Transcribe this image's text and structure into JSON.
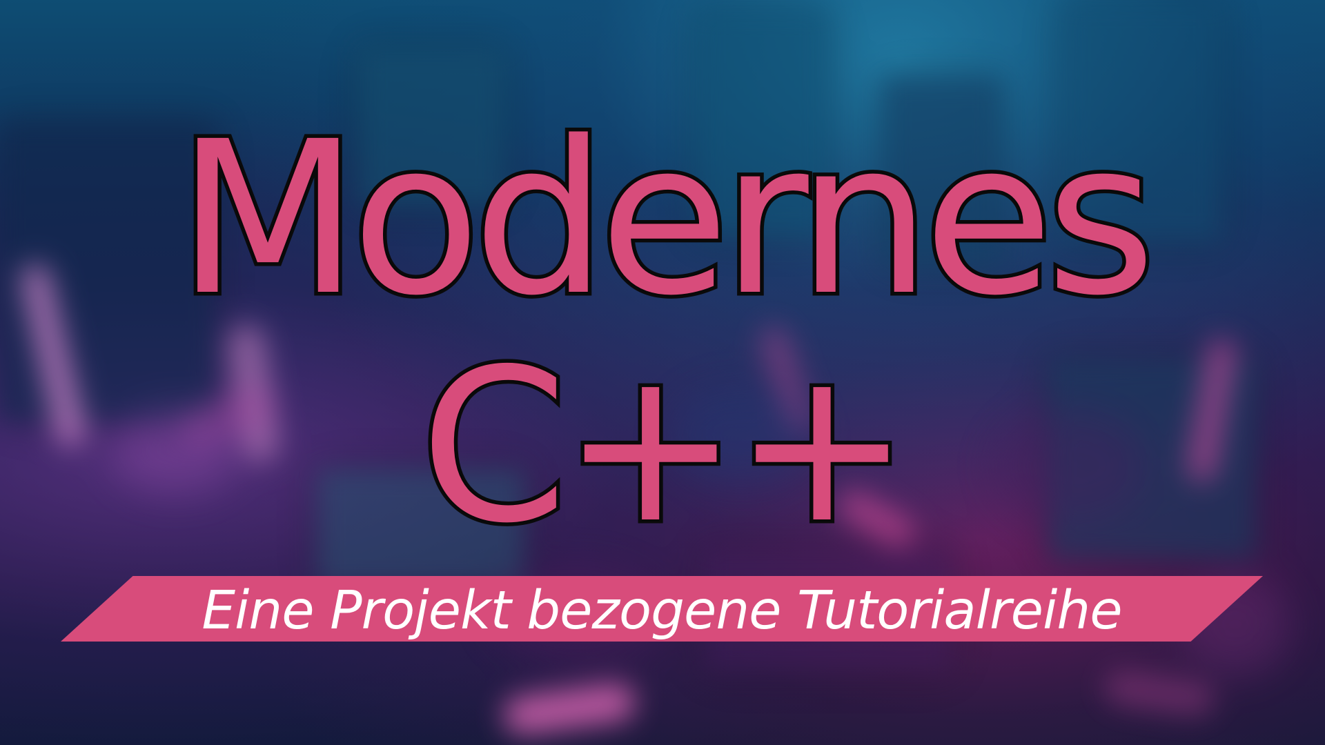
{
  "title": {
    "line1": "Modernes",
    "line2": "C++"
  },
  "subtitle": {
    "text": "Eine Projekt bezogene Tutorialreihe"
  },
  "colors": {
    "accent": "#d84c7b",
    "outline": "#0a0a0a",
    "subtitle_text": "#ffffff",
    "background_dark": "#0d1a3a",
    "background_blue": "#0e4d73",
    "background_purple": "#18153e"
  }
}
